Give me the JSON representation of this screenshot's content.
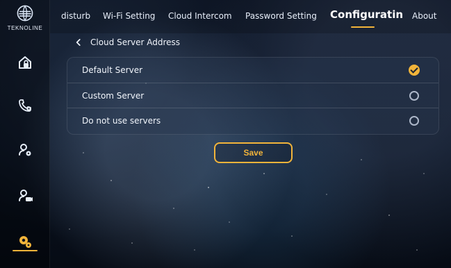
{
  "brand": {
    "name": "TEKNOLINE"
  },
  "sidebar": {
    "items": [
      {
        "icon": "home-lock-icon"
      },
      {
        "icon": "phone-settings-icon"
      },
      {
        "icon": "user-settings-icon"
      },
      {
        "icon": "user-video-icon"
      },
      {
        "icon": "configuration-icon",
        "active": true
      }
    ],
    "accent": "#f2b43a"
  },
  "tabs": [
    {
      "label": "disturb"
    },
    {
      "label": "Wi-Fi Setting"
    },
    {
      "label": "Cloud Intercom"
    },
    {
      "label": "Password Setting"
    },
    {
      "label": "Configuratin",
      "active": true
    },
    {
      "label": "About"
    }
  ],
  "breadcrumb": {
    "title": "Cloud Server Address"
  },
  "options": [
    {
      "label": "Default Server",
      "checked": true
    },
    {
      "label": "Custom Server",
      "checked": false
    },
    {
      "label": "Do not use servers",
      "checked": false
    }
  ],
  "actions": {
    "save_label": "Save"
  }
}
